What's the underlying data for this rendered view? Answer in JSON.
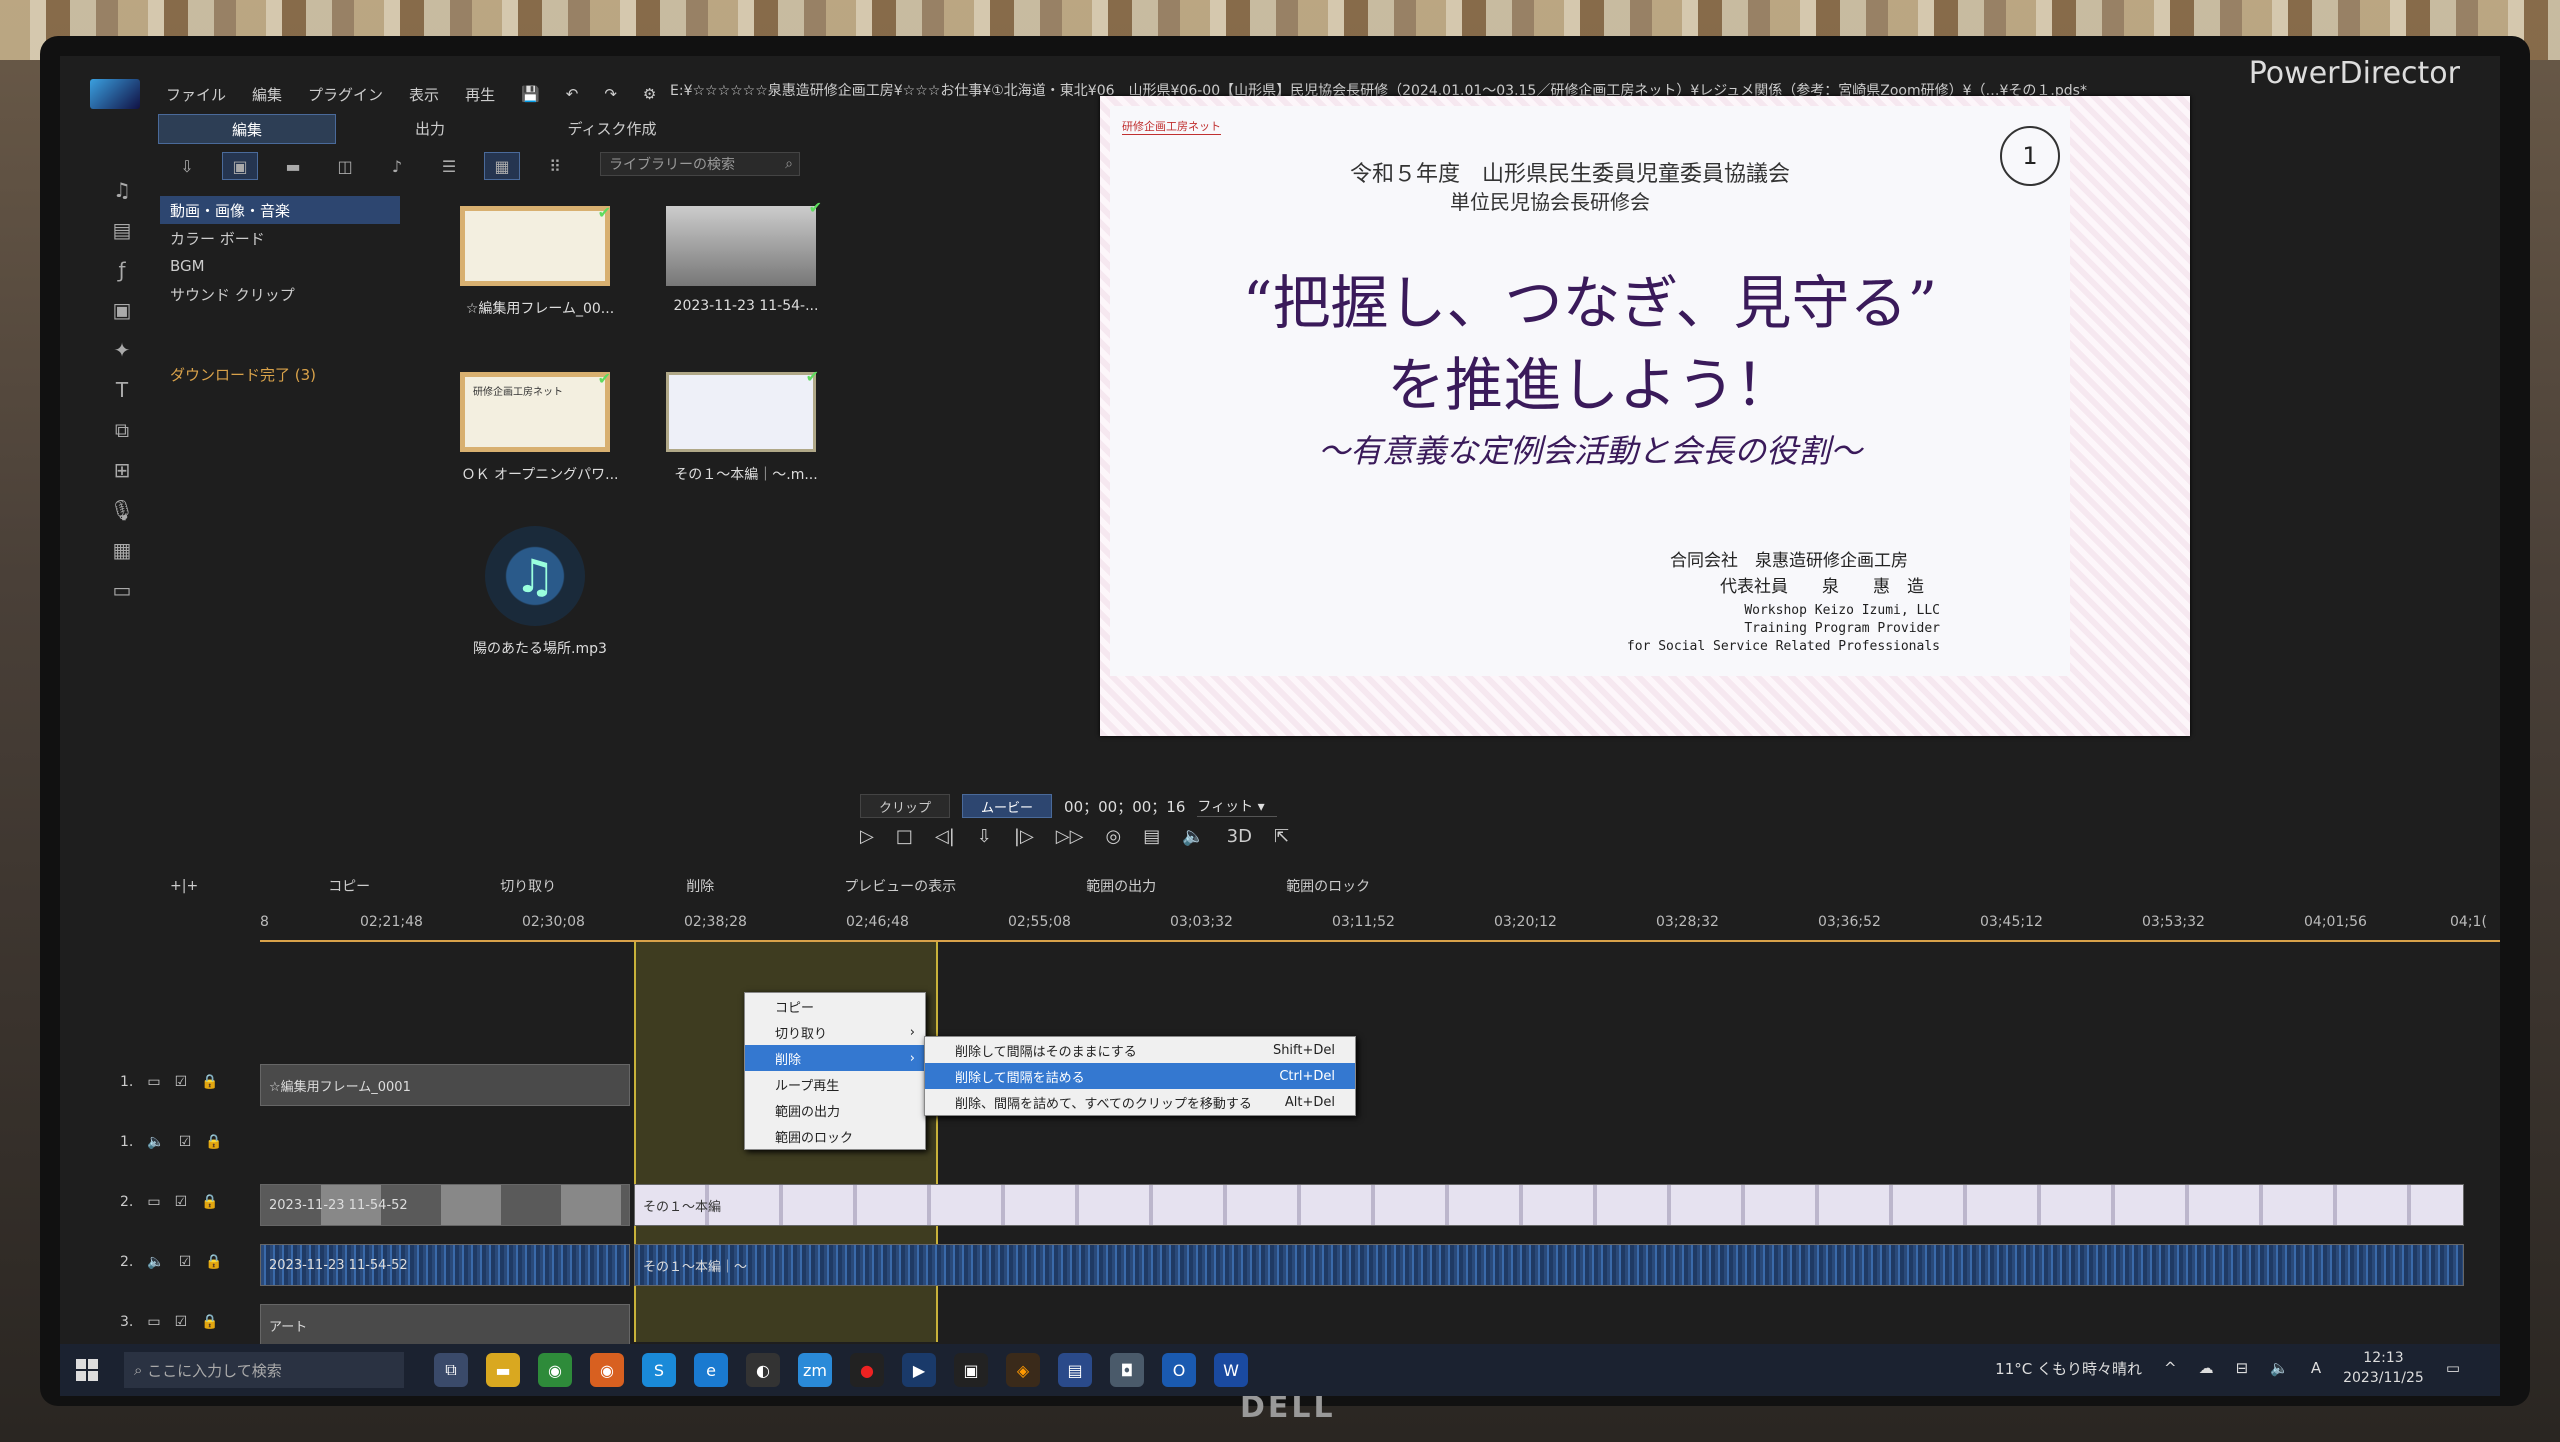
{
  "app": {
    "brand": "PowerDirector",
    "title_path": "E:¥☆☆☆☆☆☆泉惠造研修企画工房¥☆☆☆お仕事¥①北海道・東北¥06　山形県¥06-00【山形県】民児協会長研修（2024.01.01～03.15／研修企画工房ネット）¥レジュメ関係（参考：宮崎県Zoom研修）¥（…¥その１.pds*",
    "menu": [
      "ファイル",
      "編集",
      "プラグイン",
      "表示",
      "再生"
    ],
    "modes": [
      {
        "label": "編集",
        "active": true
      },
      {
        "label": "出力",
        "active": false
      },
      {
        "label": "ディスク作成",
        "active": false
      }
    ]
  },
  "library": {
    "search_placeholder": "ライブラリーの検索",
    "categories": [
      {
        "label": "動画・画像・音楽",
        "active": true
      },
      {
        "label": "カラー ボード",
        "active": false
      },
      {
        "label": "BGM",
        "active": false
      },
      {
        "label": "サウンド クリップ",
        "active": false
      }
    ],
    "download_label": "ダウンロード完了 (3)",
    "media": [
      {
        "label": "☆編集用フレーム_00...",
        "kind": "frame"
      },
      {
        "label": "2023-11-23 11-54-...",
        "kind": "person"
      },
      {
        "label": "ＯＫ オープニングパワ...",
        "kind": "frame",
        "badge": "研修企画工房ネット"
      },
      {
        "label": "その１～本編｜～.m...",
        "kind": "doc"
      },
      {
        "label": "陽のあたる場所.mp3",
        "kind": "music"
      }
    ]
  },
  "preview": {
    "badge": "研修企画工房ネット",
    "page_number": "1",
    "line1": "令和５年度　山形県民生委員児童委員協議会",
    "line2": "単位民児協会長研修会",
    "title1": "“把握し、つなぎ、見守る”",
    "title2": "を推進しよう！",
    "subtitle": "～有意義な定例会活動と会長の役割～",
    "company": "合同会社　泉惠造研修企画工房",
    "representative": "代表社員　　泉　　惠　造",
    "eng1": "Workshop Keizo Izumi, LLC",
    "eng2": "Training Program Provider",
    "eng3": "for Social Service Related Professionals"
  },
  "player": {
    "clip_label": "クリップ",
    "movie_label": "ムービー",
    "timecode": "00；00；00；16",
    "fit_label": "フィット",
    "threed_label": "3D"
  },
  "timeline": {
    "toolbar": [
      "コピー",
      "切り取り",
      "削除",
      "プレビューの表示",
      "範囲の出力",
      "範囲のロック"
    ],
    "ruler": [
      "8",
      "02;21;48",
      "02;30;08",
      "02;38;28",
      "02;46;48",
      "02;55;08",
      "03;03;32",
      "03;11;52",
      "03;20;12",
      "03;28;32",
      "03;36;52",
      "03;45;12",
      "03;53;32",
      "04;01;56",
      "04;1("
    ],
    "tracks": [
      {
        "number": "1.",
        "kind": "video",
        "clip": "☆編集用フレーム_0001"
      },
      {
        "number": "1.",
        "kind": "audio",
        "clip": ""
      },
      {
        "number": "2.",
        "kind": "video",
        "clip": "2023-11-23 11-54-52",
        "clip2": "その１～本編"
      },
      {
        "number": "2.",
        "kind": "audio",
        "clip": "2023-11-23 11-54-52",
        "clip2": "その１～本編｜～"
      },
      {
        "number": "3.",
        "kind": "video",
        "clip": "アート"
      }
    ]
  },
  "context_menu": {
    "items": [
      {
        "label": "コピー",
        "highlighted": false,
        "submenu": false
      },
      {
        "label": "切り取り",
        "highlighted": false,
        "submenu": true
      },
      {
        "label": "削除",
        "highlighted": true,
        "submenu": true
      },
      {
        "label": "ループ再生",
        "highlighted": false,
        "submenu": false
      },
      {
        "label": "範囲の出力",
        "highlighted": false,
        "submenu": false
      },
      {
        "label": "範囲のロック",
        "highlighted": false,
        "submenu": false
      }
    ],
    "submenu": [
      {
        "label": "削除して間隔はそのままにする",
        "shortcut": "Shift+Del",
        "highlighted": false
      },
      {
        "label": "削除して間隔を詰める",
        "shortcut": "Ctrl+Del",
        "highlighted": true
      },
      {
        "label": "削除、間隔を詰めて、すべてのクリップを移動する",
        "shortcut": "Alt+Del",
        "highlighted": false
      }
    ]
  },
  "taskbar": {
    "search_placeholder": "ここに入力して検索",
    "weather": "11°C くもり時々晴れ",
    "ime": "A",
    "time": "12:13",
    "date": "2023/11/25"
  },
  "bezel": {
    "brand": "DELL"
  }
}
